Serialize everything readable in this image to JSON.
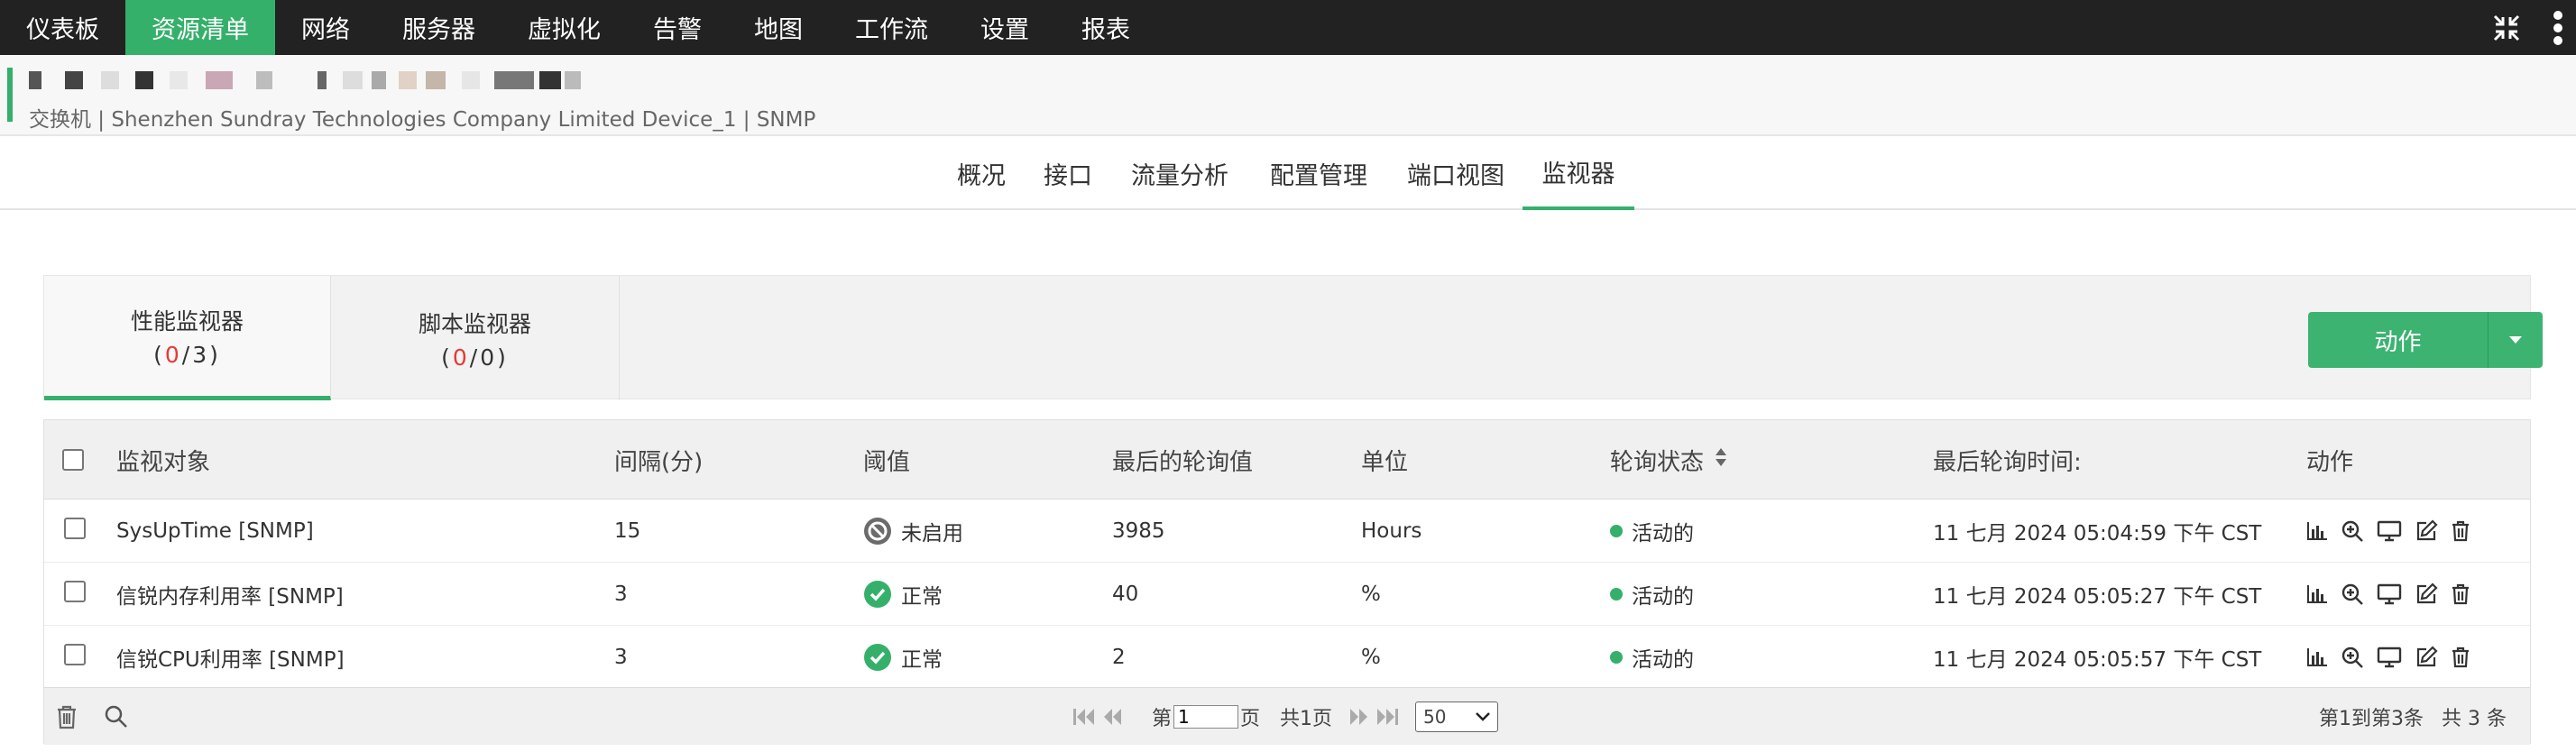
{
  "nav": {
    "items": [
      "仪表板",
      "资源清单",
      "网络",
      "服务器",
      "虚拟化",
      "告警",
      "地图",
      "工作流",
      "设置",
      "报表"
    ],
    "active_index": 1,
    "accent_color": "#35b06b",
    "right_icons": [
      "collapse-icon",
      "more-vertical-icon"
    ]
  },
  "device": {
    "subtitle": "交换机 | Shenzhen Sundray Technologies Company Limited Device_1  | SNMP"
  },
  "subtabs": [
    "概况",
    "接口",
    "流量分析",
    "配置管理",
    "端口视图",
    "监视器"
  ],
  "subtab_active": 5,
  "monitor_tabs": [
    {
      "label": "性能监视器",
      "red": "0",
      "total": "3"
    },
    {
      "label": "脚本监视器",
      "red": "0",
      "total": "0"
    }
  ],
  "action_button": "动作",
  "table": {
    "headers": [
      "监视对象",
      "间隔(分)",
      "阈值",
      "最后的轮询值",
      "单位",
      "轮询状态",
      "最后轮询时间:",
      "动作"
    ],
    "rows": [
      {
        "name": "SysUpTime [SNMP]",
        "interval": "15",
        "threshold": "未启用",
        "threshold_state": "disabled",
        "value": "3985",
        "unit": "Hours",
        "status": "活动的",
        "time": "11 七月 2024 05:04:59 下午 CST"
      },
      {
        "name": "信锐内存利用率 [SNMP]",
        "interval": "3",
        "threshold": "正常",
        "threshold_state": "ok",
        "value": "40",
        "unit": "%",
        "status": "活动的",
        "time": "11 七月 2024 05:05:27 下午 CST"
      },
      {
        "name": "信锐CPU利用率 [SNMP]",
        "interval": "3",
        "threshold": "正常",
        "threshold_state": "ok",
        "value": "2",
        "unit": "%",
        "status": "活动的",
        "time": "11 七月 2024 05:05:57 下午 CST"
      }
    ],
    "row_action_icons": [
      "bar-chart-icon",
      "zoom-icon",
      "monitor-icon",
      "edit-icon",
      "trash-icon"
    ]
  },
  "footer": {
    "page_prefix": "第",
    "page_value": "1",
    "page_suffix": "页",
    "total_pages": "共1页",
    "page_size": "50",
    "range": "第1到第3条",
    "total": "共 3 条"
  }
}
